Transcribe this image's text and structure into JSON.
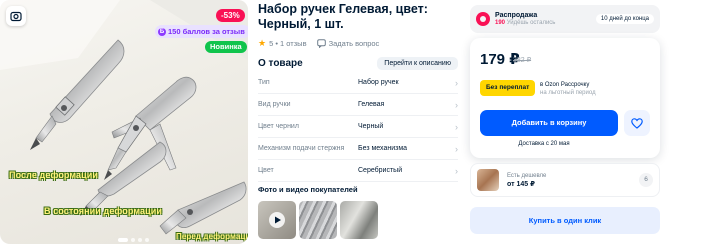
{
  "product_image": {
    "discount_badge": "-53%",
    "points_badge": "150 баллов за отзыв",
    "points_icon": "ozon-points-icon",
    "new_badge": "Новинка",
    "caption_after": "После деформации",
    "caption_deformed": "В состоянии деформации",
    "caption_before": "Перед деформацией"
  },
  "product": {
    "title": "Набор ручек Гелевая, цвет: Черный, 1 шт.",
    "rating_text": "5 • 1 отзыв",
    "ask_question": "Задать вопрос"
  },
  "about": {
    "heading": "О товаре",
    "goto_description": "Перейти к описанию",
    "specs": [
      {
        "key": "Тип",
        "value": "Набор ручек"
      },
      {
        "key": "Вид ручки",
        "value": "Гелевая"
      },
      {
        "key": "Цвет чернил",
        "value": "Черный"
      },
      {
        "key": "Механизм подачи стержня",
        "value": "Без механизма"
      },
      {
        "key": "Цвет",
        "value": "Серебристый"
      }
    ]
  },
  "customer_photos": {
    "heading": "Фото и видео покупателей"
  },
  "seller": {
    "name": "Распродажа",
    "info": "Уйдёшь остались",
    "info_prefix": "190",
    "badge": "10 дней до конца"
  },
  "price": {
    "current": "179 ₽",
    "old": "382 ₽",
    "credit_badge": "Без переплат",
    "credit_line1": "в Ozon Рассрочку",
    "credit_line2": "на льготный период",
    "add_to_cart": "Добавить в корзину",
    "delivery": "Доставка с 20 мая"
  },
  "cheaper": {
    "label": "Есть дешевле",
    "price": "от 145 ₽",
    "count": "6"
  },
  "buy_now": "Купить в один клик",
  "colors": {
    "accent": "#005bff",
    "sale": "#f91155",
    "new": "#10c44c",
    "points": "#7b2bf9",
    "credit": "#ffd600"
  }
}
